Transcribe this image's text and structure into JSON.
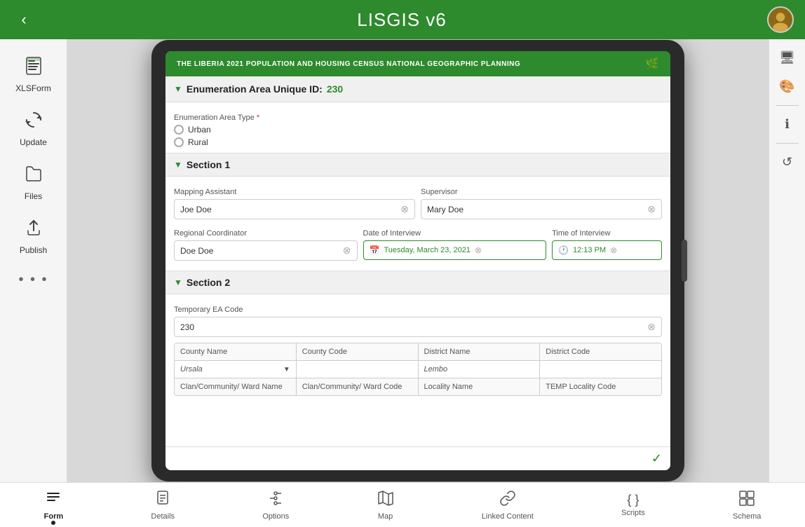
{
  "app": {
    "title": "LISGIS v6"
  },
  "topbar": {
    "back_label": "‹",
    "title": "LISGIS v6"
  },
  "sidebar": {
    "items": [
      {
        "id": "xlsform",
        "label": "XLSForm",
        "icon": "📋"
      },
      {
        "id": "update",
        "label": "Update",
        "icon": "🔄"
      },
      {
        "id": "files",
        "label": "Files",
        "icon": "📁"
      },
      {
        "id": "publish",
        "label": "Publish",
        "icon": "☁"
      }
    ],
    "more": "• • •"
  },
  "form": {
    "header_text": "THE LIBERIA 2021 POPULATION AND HOUSING CENSUS  NATIONAL GEOGRAPHIC PLANNING",
    "ea_label": "Enumeration Area Unique ID:",
    "ea_id": "230",
    "ea_type_label": "Enumeration Area Type",
    "ea_type_required": true,
    "ea_types": [
      "Urban",
      "Rural"
    ],
    "section1_title": "Section 1",
    "mapping_assistant_label": "Mapping Assistant",
    "mapping_assistant_value": "Joe Doe",
    "supervisor_label": "Supervisor",
    "supervisor_value": "Mary Doe",
    "regional_coordinator_label": "Regional Coordinator",
    "regional_coordinator_value": "Doe Doe",
    "date_label": "Date of Interview",
    "date_value": "Tuesday, March 23, 2021",
    "time_label": "Time of Interview",
    "time_value": "12:13 PM",
    "section2_title": "Section 2",
    "temp_ea_code_label": "Temporary EA Code",
    "temp_ea_code_value": "230",
    "county_name_label": "County Name",
    "county_name_value": "Ursala",
    "county_code_label": "County Code",
    "county_code_value": "",
    "district_name_label": "District Name",
    "district_name_value": "Lembo",
    "district_code_label": "District Code",
    "district_code_value": "",
    "clan_ward_name_label": "Clan/Community/ Ward Name",
    "clan_ward_code_label": "Clan/Community/ Ward Code",
    "locality_name_label": "Locality Name",
    "temp_locality_code_label": "TEMP Locality Code"
  },
  "bottom_nav": {
    "items": [
      {
        "id": "form",
        "label": "Form",
        "active": true,
        "icon": "≡"
      },
      {
        "id": "details",
        "label": "Details",
        "active": false,
        "icon": "📄"
      },
      {
        "id": "options",
        "label": "Options",
        "active": false,
        "icon": "⚙"
      },
      {
        "id": "map",
        "label": "Map",
        "active": false,
        "icon": "🗺"
      },
      {
        "id": "linked-content",
        "label": "Linked Content",
        "active": false,
        "icon": "🔗"
      },
      {
        "id": "scripts",
        "label": "Scripts",
        "active": false,
        "icon": "{ }"
      },
      {
        "id": "schema",
        "label": "Schema",
        "active": false,
        "icon": "⊞"
      }
    ]
  },
  "right_sidebar": {
    "icons": [
      {
        "id": "monitor",
        "symbol": "🖥"
      },
      {
        "id": "palette",
        "symbol": "🎨"
      },
      {
        "id": "info",
        "symbol": "ℹ"
      },
      {
        "id": "undo",
        "symbol": "↺"
      }
    ]
  }
}
